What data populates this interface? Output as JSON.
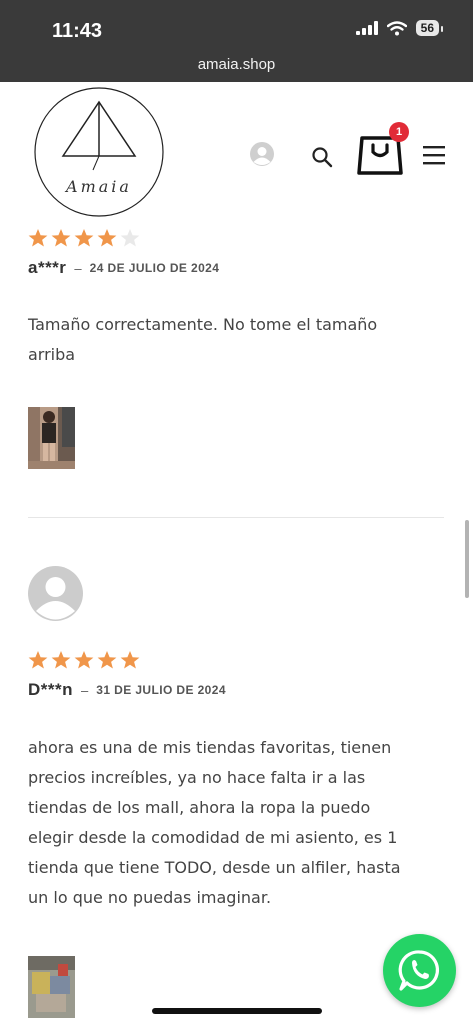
{
  "status_bar": {
    "time": "11:43",
    "battery": "56",
    "url": "amaia.shop"
  },
  "header": {
    "logo_icon": "amaia-logo",
    "logo_text": "Amaia",
    "cart_count": "1",
    "icons": [
      "user-icon",
      "search-icon",
      "shopping-bag-icon",
      "menu-icon"
    ]
  },
  "reviews": [
    {
      "rating": 4,
      "max_rating": 5,
      "author": "a***r",
      "dash": "–",
      "date": "24 DE JULIO DE 2024",
      "text_lines": [
        "Tamaño correctamente. No tome el tamaño",
        "arriba"
      ]
    },
    {
      "rating": 5,
      "max_rating": 5,
      "author": "D***n",
      "dash": "–",
      "date": "31 DE JULIO DE 2024",
      "text_lines": [
        "ahora es una de mis tiendas favoritas, tienen",
        "precios increíbles, ya no hace falta ir a las",
        "tiendas de los mall, ahora la ropa la puedo",
        "elegir desde la comodidad de mi asiento, es 1",
        "tienda que tiene TODO, desde un alfiler, hasta",
        "un lo que no puedas imaginar."
      ]
    }
  ],
  "colors": {
    "star_filled": "#f0964a",
    "star_empty": "#e9e9e9",
    "badge": "#e12b37",
    "whatsapp": "#25d366",
    "status_bar": "#3a3a3a"
  }
}
